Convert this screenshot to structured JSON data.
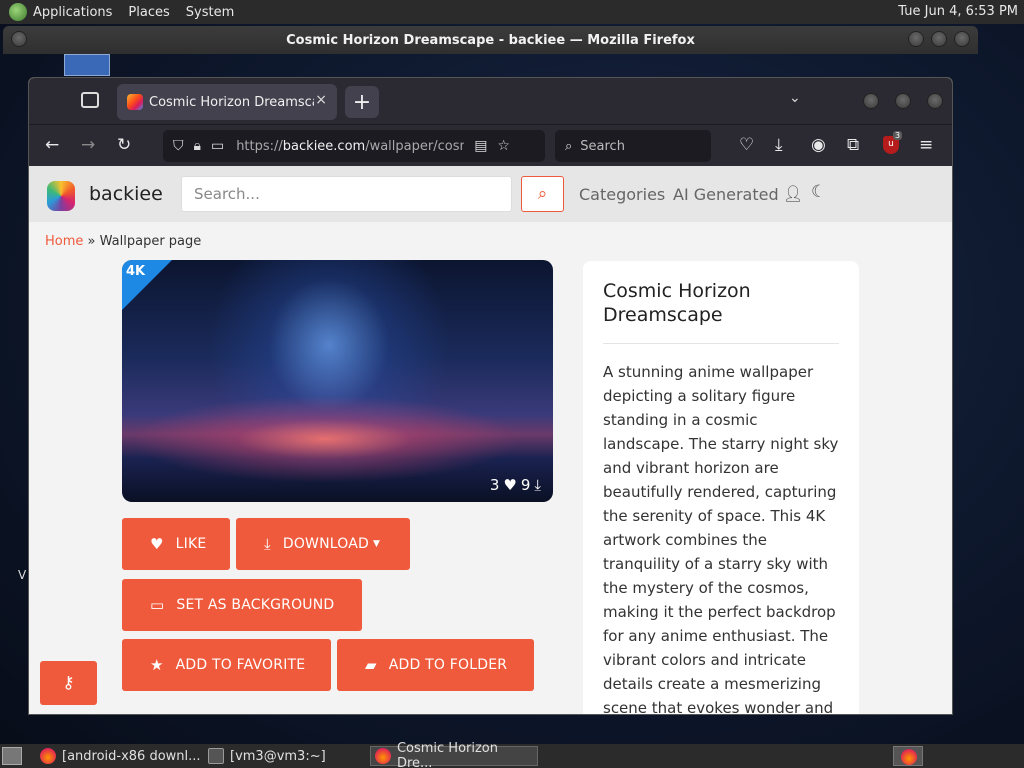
{
  "top_panel": {
    "menus": [
      "Applications",
      "Places",
      "System"
    ],
    "clock": "Tue Jun  4,  6:53 PM"
  },
  "window": {
    "title": "Cosmic Horizon Dreamscape - backiee — Mozilla Firefox"
  },
  "browser": {
    "tab_title": "Cosmic Horizon Dreamscape - backiee",
    "tab_close": "×",
    "new_tab": "+",
    "url_prefix": "https://",
    "url_host": "backiee.com",
    "url_path": "/wallpaper/cosmic-horizon-dreamscape",
    "search_placeholder": "Search",
    "ublock_count": "3"
  },
  "site": {
    "name": "backiee",
    "search_placeholder": "Search...",
    "nav": [
      "Categories",
      "AI Generated"
    ],
    "breadcrumb": {
      "home": "Home",
      "separator": "»",
      "current": "Wallpaper page"
    },
    "wallpaper": {
      "badge": "4K",
      "likes": "3",
      "downloads": "9"
    },
    "buttons": {
      "like": "LIKE",
      "download": "DOWNLOAD",
      "set_background": "SET AS BACKGROUND",
      "add_favorite": "ADD TO FAVORITE",
      "add_folder": "ADD TO FOLDER"
    },
    "info": {
      "title": "Cosmic Horizon Dreamscape",
      "description": "A stunning anime wallpaper depicting a solitary figure standing in a cosmic landscape. The starry night sky and vibrant horizon are beautifully rendered, capturing the serenity of space. This 4K artwork combines the tranquility of a starry sky with the mystery of the cosmos, making it the perfect backdrop for any anime enthusiast. The vibrant colors and intricate details create a mesmerizing scene that evokes wonder and imagination."
    },
    "accent_color": "#ef5a3c"
  },
  "desktop": {
    "stray_text": "V"
  },
  "taskbar": {
    "tasks": [
      "[android-x86 downl...",
      "[vm3@vm3:~]",
      "Cosmic Horizon Dre..."
    ]
  }
}
